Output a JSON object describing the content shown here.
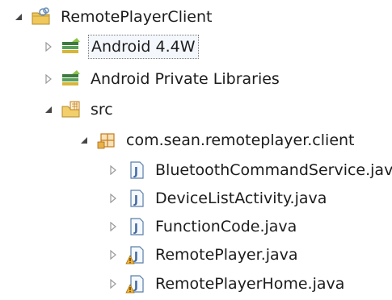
{
  "tree": {
    "items": [
      {
        "label": "RemotePlayerClient",
        "icon": "project-icon",
        "expander": "expanded"
      },
      {
        "label": "Android 4.4W",
        "icon": "library-icon",
        "expander": "collapsed"
      },
      {
        "label": "Android Private Libraries",
        "icon": "library-icon",
        "expander": "collapsed"
      },
      {
        "label": "src",
        "icon": "source-folder-icon",
        "expander": "expanded"
      },
      {
        "label": "com.sean.remoteplayer.client",
        "icon": "package-icon",
        "expander": "expanded"
      },
      {
        "label": "BluetoothCommandService.java",
        "icon": "java-file-icon",
        "expander": "collapsed"
      },
      {
        "label": "DeviceListActivity.java",
        "icon": "java-file-icon",
        "expander": "collapsed"
      },
      {
        "label": "FunctionCode.java",
        "icon": "java-file-icon",
        "expander": "collapsed"
      },
      {
        "label": "RemotePlayer.java",
        "icon": "java-file-warning-icon",
        "expander": "collapsed"
      },
      {
        "label": "RemotePlayerHome.java",
        "icon": "java-file-warning-icon",
        "expander": "collapsed"
      }
    ]
  }
}
